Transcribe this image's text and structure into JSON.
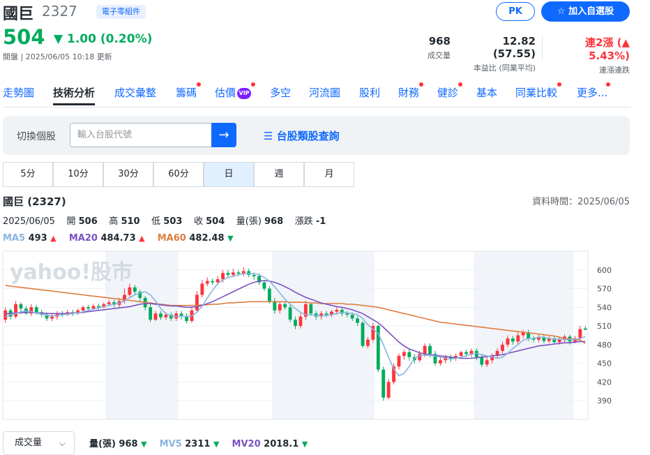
{
  "header": {
    "name": "國巨",
    "code": "2327",
    "sector": "電子零組件",
    "price": "504",
    "change": "▼ 1.00 (0.20%)",
    "market_time": "開盤 | 2025/06/05 10:18 更新",
    "pk_label": "PK",
    "watchlist_label": "☆ 加入自選股"
  },
  "stats": [
    {
      "value": "968",
      "label": "成交量"
    },
    {
      "value": "12.82 (57.55)",
      "label": "本益比 (同業平均)"
    },
    {
      "value": "連2漲 (▲ 5.43%)",
      "label": "連漲連跌"
    }
  ],
  "tabs": [
    {
      "label": "走勢圖",
      "dot": false
    },
    {
      "label": "技術分析",
      "dot": false,
      "active": true
    },
    {
      "label": "成交彙整",
      "dot": false
    },
    {
      "label": "籌碼",
      "dot": true
    },
    {
      "label": "估價",
      "dot": true,
      "vip": "VIP"
    },
    {
      "label": "多空",
      "dot": false
    },
    {
      "label": "河流圖",
      "dot": false
    },
    {
      "label": "股利",
      "dot": false
    },
    {
      "label": "財務",
      "dot": true
    },
    {
      "label": "健診",
      "dot": true
    },
    {
      "label": "基本",
      "dot": false
    },
    {
      "label": "同業比較",
      "dot": true
    },
    {
      "label": "更多...",
      "dot": true
    }
  ],
  "search": {
    "label": "切換個股",
    "placeholder": "輸入台股代號",
    "category_link": "☰ 台股類股查詢"
  },
  "periods": [
    "5分",
    "10分",
    "30分",
    "60分",
    "日",
    "週",
    "月"
  ],
  "selected_period": "日",
  "chart": {
    "title": "國巨 (2327)",
    "data_time": "資料時間：2025/06/05",
    "date": "2025/06/05",
    "open_label": "開",
    "open": "506",
    "high_label": "高",
    "high": "510",
    "low_label": "低",
    "low": "503",
    "close_label": "收",
    "close": "504",
    "vol_label": "量(張)",
    "vol": "968",
    "chg_label": "漲跌",
    "chg": "-1",
    "ma5_label": "MA5",
    "ma5": "493",
    "ma20_label": "MA20",
    "ma20": "484.73",
    "ma60_label": "MA60",
    "ma60": "482.48",
    "watermark": "yahoo!股市"
  },
  "colors": {
    "up": "#ff333a",
    "down": "#00ab5e",
    "ma5": "#8ab4e0",
    "ma20": "#7b52c2",
    "ma60": "#e07c40"
  },
  "chart_data": {
    "type": "candlestick",
    "ylim": [
      360,
      630
    ],
    "yticks": [
      600,
      570,
      540,
      510,
      480,
      450,
      420,
      390
    ],
    "candles": [
      [
        520,
        535,
        540,
        515
      ],
      [
        535,
        525,
        538,
        520
      ],
      [
        525,
        545,
        550,
        522
      ],
      [
        545,
        538,
        548,
        532
      ],
      [
        538,
        530,
        542,
        528
      ],
      [
        530,
        540,
        545,
        526
      ],
      [
        540,
        532,
        544,
        528
      ],
      [
        532,
        528,
        536,
        524
      ],
      [
        528,
        522,
        532,
        518
      ],
      [
        522,
        525,
        530,
        518
      ],
      [
        525,
        530,
        534,
        520
      ],
      [
        530,
        528,
        534,
        524
      ],
      [
        528,
        532,
        536,
        526
      ],
      [
        532,
        530,
        536,
        526
      ],
      [
        530,
        535,
        538,
        528
      ],
      [
        535,
        540,
        543,
        530
      ],
      [
        540,
        538,
        544,
        534
      ],
      [
        538,
        542,
        546,
        536
      ],
      [
        542,
        540,
        546,
        536
      ],
      [
        540,
        545,
        548,
        538
      ],
      [
        545,
        548,
        552,
        542
      ],
      [
        548,
        544,
        552,
        540
      ],
      [
        544,
        550,
        555,
        540
      ],
      [
        550,
        560,
        570,
        546
      ],
      [
        560,
        572,
        578,
        556
      ],
      [
        572,
        565,
        576,
        560
      ],
      [
        565,
        555,
        568,
        550
      ],
      [
        555,
        540,
        558,
        535
      ],
      [
        540,
        520,
        545,
        516
      ],
      [
        520,
        530,
        534,
        518
      ],
      [
        530,
        524,
        534,
        520
      ],
      [
        524,
        528,
        532,
        520
      ],
      [
        528,
        522,
        532,
        518
      ],
      [
        522,
        530,
        534,
        518
      ],
      [
        530,
        526,
        534,
        520
      ],
      [
        526,
        518,
        530,
        514
      ],
      [
        518,
        535,
        540,
        515
      ],
      [
        535,
        560,
        566,
        532
      ],
      [
        560,
        578,
        584,
        556
      ],
      [
        578,
        582,
        588,
        574
      ],
      [
        582,
        580,
        586,
        576
      ],
      [
        580,
        585,
        590,
        576
      ],
      [
        585,
        595,
        600,
        580
      ],
      [
        595,
        592,
        600,
        588
      ],
      [
        592,
        596,
        602,
        588
      ],
      [
        596,
        594,
        600,
        590
      ],
      [
        594,
        598,
        604,
        590
      ],
      [
        598,
        592,
        602,
        588
      ],
      [
        592,
        590,
        596,
        584
      ],
      [
        590,
        580,
        594,
        576
      ],
      [
        580,
        570,
        584,
        566
      ],
      [
        570,
        550,
        574,
        546
      ],
      [
        550,
        535,
        555,
        530
      ],
      [
        535,
        545,
        548,
        530
      ],
      [
        545,
        540,
        548,
        536
      ],
      [
        540,
        520,
        544,
        516
      ],
      [
        520,
        510,
        525,
        505
      ],
      [
        510,
        525,
        530,
        506
      ],
      [
        525,
        545,
        550,
        520
      ],
      [
        545,
        530,
        548,
        526
      ],
      [
        530,
        525,
        534,
        520
      ],
      [
        525,
        530,
        534,
        520
      ],
      [
        530,
        528,
        534,
        524
      ],
      [
        528,
        533,
        536,
        524
      ],
      [
        533,
        536,
        540,
        528
      ],
      [
        536,
        530,
        540,
        526
      ],
      [
        530,
        528,
        534,
        524
      ],
      [
        528,
        522,
        532,
        518
      ],
      [
        522,
        515,
        526,
        510
      ],
      [
        515,
        478,
        518,
        475
      ],
      [
        478,
        488,
        492,
        474
      ],
      [
        488,
        510,
        515,
        484
      ],
      [
        510,
        440,
        512,
        436
      ],
      [
        440,
        395,
        445,
        390
      ],
      [
        395,
        420,
        425,
        392
      ],
      [
        420,
        445,
        450,
        416
      ],
      [
        445,
        462,
        466,
        440
      ],
      [
        462,
        468,
        472,
        456
      ],
      [
        468,
        460,
        472,
        454
      ],
      [
        460,
        455,
        465,
        450
      ],
      [
        455,
        465,
        470,
        452
      ],
      [
        465,
        478,
        482,
        460
      ],
      [
        478,
        465,
        482,
        460
      ],
      [
        465,
        450,
        470,
        446
      ],
      [
        450,
        455,
        460,
        446
      ],
      [
        455,
        460,
        464,
        450
      ],
      [
        460,
        458,
        464,
        452
      ],
      [
        458,
        462,
        466,
        454
      ],
      [
        462,
        468,
        470,
        458
      ],
      [
        468,
        465,
        472,
        460
      ],
      [
        465,
        470,
        474,
        460
      ],
      [
        470,
        460,
        474,
        455
      ],
      [
        460,
        448,
        465,
        444
      ],
      [
        448,
        455,
        460,
        444
      ],
      [
        455,
        462,
        466,
        450
      ],
      [
        462,
        470,
        474,
        458
      ],
      [
        470,
        480,
        485,
        466
      ],
      [
        480,
        490,
        495,
        476
      ],
      [
        490,
        485,
        494,
        480
      ],
      [
        485,
        495,
        500,
        480
      ],
      [
        495,
        500,
        504,
        490
      ],
      [
        500,
        490,
        504,
        486
      ],
      [
        490,
        488,
        494,
        484
      ],
      [
        488,
        492,
        496,
        484
      ],
      [
        492,
        486,
        496,
        482
      ],
      [
        486,
        490,
        494,
        482
      ],
      [
        490,
        484,
        494,
        480
      ],
      [
        484,
        488,
        492,
        480
      ],
      [
        488,
        493,
        496,
        484
      ],
      [
        493,
        485,
        496,
        480
      ],
      [
        485,
        490,
        494,
        482
      ],
      [
        490,
        505,
        510,
        486
      ],
      [
        506,
        504,
        510,
        503
      ]
    ],
    "ma5": [
      525,
      528,
      530,
      533,
      534,
      533,
      531,
      529,
      527,
      526,
      527,
      528,
      529,
      530,
      531,
      533,
      535,
      537,
      539,
      541,
      543,
      545,
      547,
      550,
      555,
      560,
      563,
      565,
      560,
      550,
      538,
      530,
      526,
      525,
      526,
      525,
      526,
      532,
      542,
      555,
      567,
      578,
      584,
      588,
      590,
      592,
      594,
      594,
      594,
      592,
      588,
      582,
      573,
      563,
      553,
      545,
      538,
      532,
      528,
      528,
      527,
      526,
      527,
      528,
      530,
      532,
      531,
      530,
      528,
      522,
      512,
      505,
      498,
      480,
      460,
      441,
      430,
      434,
      445,
      458,
      462,
      463,
      463,
      462,
      460,
      458,
      457,
      458,
      460,
      462,
      465,
      466,
      464,
      462,
      460,
      458,
      460,
      466,
      474,
      480,
      487,
      490,
      490,
      492,
      492,
      490,
      489,
      489,
      488,
      488,
      488,
      490,
      493
    ],
    "ma20": [
      530,
      530,
      531,
      531,
      532,
      532,
      531,
      531,
      530,
      530,
      530,
      530,
      530,
      531,
      531,
      532,
      533,
      534,
      535,
      536,
      537,
      538,
      539,
      540,
      541,
      543,
      545,
      546,
      546,
      545,
      544,
      543,
      542,
      542,
      541,
      540,
      540,
      541,
      543,
      546,
      549,
      553,
      557,
      561,
      565,
      569,
      573,
      577,
      580,
      582,
      583,
      582,
      580,
      577,
      573,
      569,
      564,
      560,
      556,
      553,
      550,
      547,
      545,
      543,
      541,
      540,
      538,
      536,
      533,
      530,
      525,
      520,
      515,
      508,
      500,
      492,
      484,
      478,
      473,
      470,
      467,
      465,
      464,
      463,
      462,
      461,
      460,
      459,
      458,
      458,
      458,
      459,
      460,
      461,
      462,
      463,
      464,
      466,
      468,
      470,
      472,
      474,
      476,
      478,
      479,
      480,
      481,
      482,
      483,
      483,
      484,
      485,
      485
    ],
    "ma60": [
      575,
      574,
      573,
      572,
      571,
      570,
      569,
      568,
      567,
      566,
      565,
      564,
      563,
      562,
      561,
      560,
      559,
      558,
      557,
      556,
      555,
      554,
      553,
      552,
      551,
      550,
      549,
      548,
      547,
      546,
      545,
      544,
      543,
      543,
      543,
      543,
      543,
      543,
      544,
      544,
      545,
      545,
      546,
      547,
      547,
      548,
      548,
      549,
      549,
      549,
      549,
      549,
      549,
      549,
      549,
      548,
      548,
      548,
      548,
      547,
      547,
      546,
      546,
      546,
      546,
      546,
      545,
      545,
      544,
      543,
      542,
      541,
      540,
      538,
      536,
      534,
      532,
      530,
      528,
      526,
      524,
      522,
      520,
      518,
      516,
      515,
      514,
      513,
      512,
      511,
      510,
      509,
      508,
      507,
      506,
      505,
      504,
      503,
      502,
      501,
      500,
      499,
      498,
      497,
      496,
      495,
      494,
      492,
      490,
      489,
      488,
      487,
      482
    ]
  },
  "volume": {
    "select_label": "成交量",
    "vol_label": "量(張)",
    "vol": "968",
    "mv5_label": "MV5",
    "mv5": "2311",
    "mv20_label": "MV20",
    "mv20": "2018.1"
  }
}
